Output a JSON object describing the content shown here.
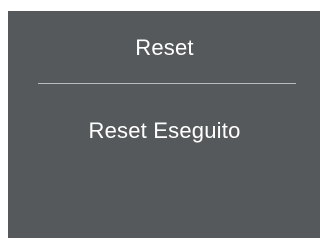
{
  "dialog": {
    "title": "Reset",
    "message": "Reset Eseguito"
  },
  "colors": {
    "panel_background": "#56595b",
    "text": "#ffffff",
    "divider": "#b9bbbc"
  }
}
